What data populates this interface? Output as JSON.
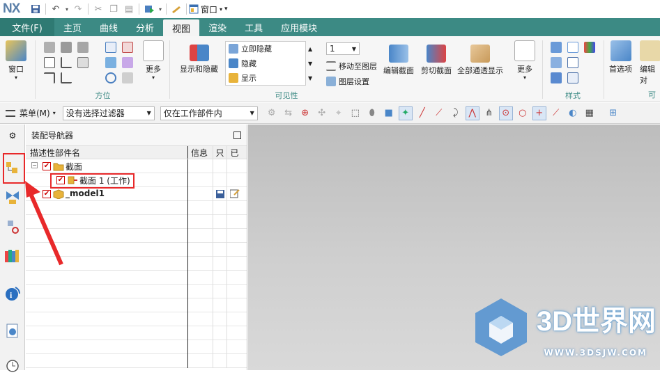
{
  "app": {
    "logo": "NX",
    "window_menu": "窗口"
  },
  "menubar": {
    "file": "文件(F)",
    "tabs": [
      "主页",
      "曲线",
      "分析",
      "视图",
      "渲染",
      "工具",
      "应用模块"
    ],
    "active_tab": "视图"
  },
  "ribbon": {
    "window_btn": "窗口",
    "orient_group": "方位",
    "more1": "更多",
    "show_hide": "显示和隐藏",
    "immediate_hide": "立即隐藏",
    "hide": "隐藏",
    "show": "显示",
    "layer_value": "1",
    "move_to_layer": "移动至图层",
    "layer_settings": "图层设置",
    "visibility_group": "可见性",
    "edit_section": "编辑截面",
    "clip_section": "剪切截面",
    "all_through_show": "全部通透显示",
    "more2": "更多",
    "style_group": "样式",
    "preferences": "首选项",
    "edit_obj": "编辑对",
    "cut_group": "可"
  },
  "toolbar2": {
    "menu": "菜单(M)",
    "filter": "没有选择过滤器",
    "scope": "仅在工作部件内"
  },
  "navigator": {
    "title": "装配导航器",
    "columns": [
      "描述性部件名",
      "信息",
      "只",
      "已"
    ],
    "rows": [
      {
        "name": "截面",
        "level": 0
      },
      {
        "name": "截面 1 (工作)",
        "level": 1
      },
      {
        "name": "_model1",
        "level": 0
      }
    ]
  },
  "watermark": {
    "text": "3D世界网",
    "url": "WWW.3DSJW.COM"
  },
  "colors": {
    "menubar": "#3c8a84",
    "highlight": "#e8292a",
    "viewport": "#c8c8c8"
  }
}
